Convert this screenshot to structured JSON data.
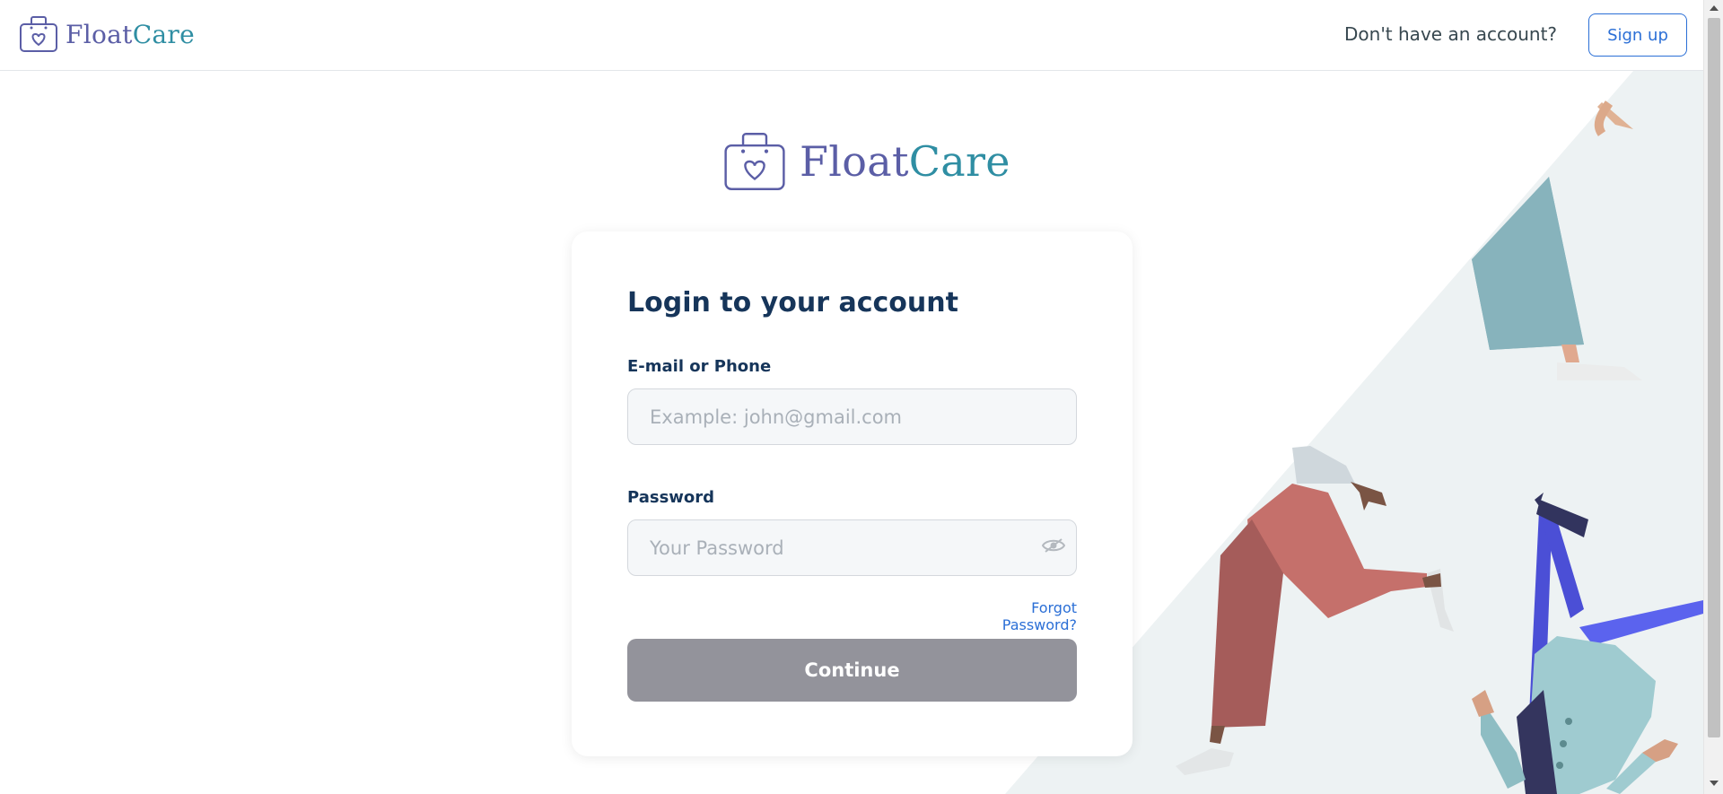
{
  "brand": {
    "name_part1": "Float",
    "name_part2": "Care",
    "color_primary": "#5b5ea6",
    "color_accent": "#2f8ea3",
    "icon": "shopping-bag-heart-icon"
  },
  "header": {
    "question": "Don't have an account?",
    "signup_label": "Sign up"
  },
  "login": {
    "title": "Login to your account",
    "email_label": "E-mail or Phone",
    "email_placeholder": "Example: john@gmail.com",
    "email_value": "",
    "password_label": "Password",
    "password_placeholder": "Your Password",
    "password_value": "",
    "password_toggle_icon": "eye-icon",
    "forgot_label": "Forgot Password?",
    "continue_label": "Continue",
    "continue_color": "#93939b",
    "link_color": "#2b6fd6"
  }
}
